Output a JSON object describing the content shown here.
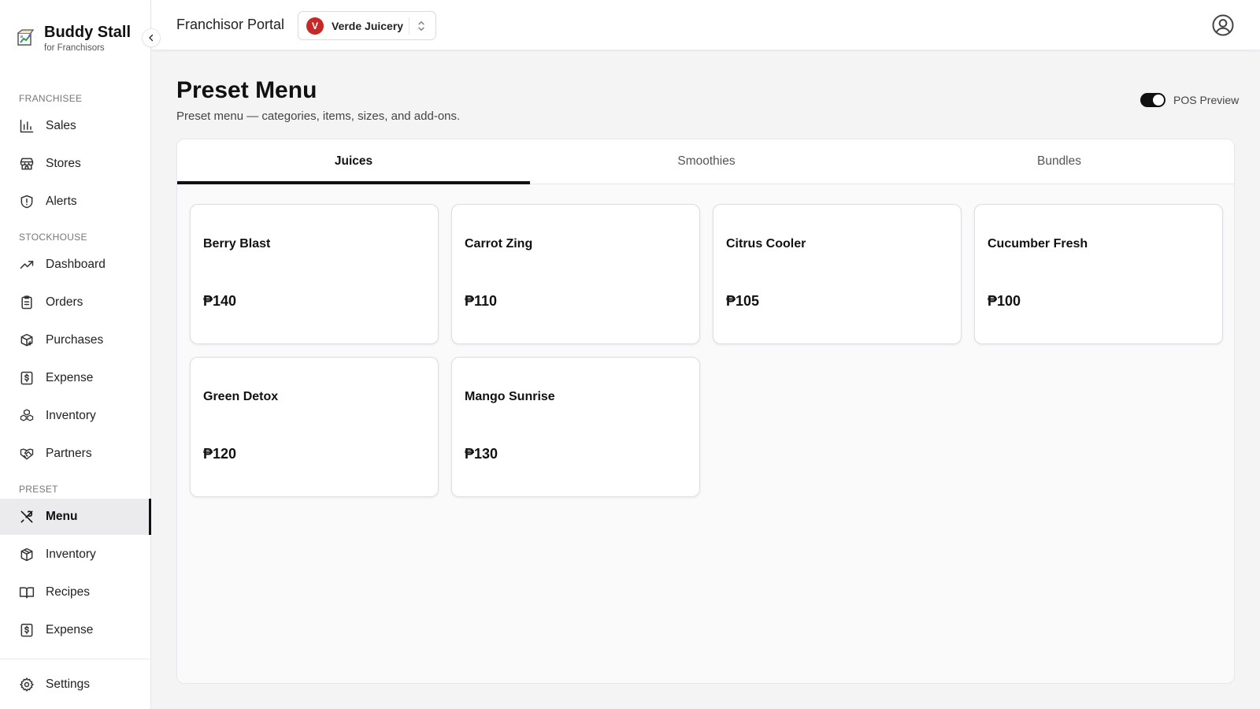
{
  "brand": {
    "name": "Buddy Stall",
    "subtitle": "for Franchisors"
  },
  "sidebar": {
    "sections": [
      {
        "title": "FRANCHISEE",
        "items": [
          {
            "label": "Sales",
            "icon": "bar-chart-icon"
          },
          {
            "label": "Stores",
            "icon": "store-icon"
          },
          {
            "label": "Alerts",
            "icon": "shield-alert-icon"
          }
        ]
      },
      {
        "title": "STOCKHOUSE",
        "items": [
          {
            "label": "Dashboard",
            "icon": "trending-up-icon"
          },
          {
            "label": "Orders",
            "icon": "clipboard-icon"
          },
          {
            "label": "Purchases",
            "icon": "package-plus-icon"
          },
          {
            "label": "Expense",
            "icon": "receipt-icon"
          },
          {
            "label": "Inventory",
            "icon": "boxes-icon"
          },
          {
            "label": "Partners",
            "icon": "handshake-icon"
          }
        ]
      },
      {
        "title": "PRESET",
        "items": [
          {
            "label": "Menu",
            "icon": "utensils-icon",
            "active": true
          },
          {
            "label": "Inventory",
            "icon": "box-icon"
          },
          {
            "label": "Recipes",
            "icon": "book-icon"
          },
          {
            "label": "Expense",
            "icon": "receipt-icon"
          }
        ]
      }
    ],
    "settings_label": "Settings"
  },
  "header": {
    "title": "Franchisor Portal",
    "selected_brand": {
      "initial": "V",
      "name": "Verde Juicery",
      "color": "#c62828"
    }
  },
  "main": {
    "title": "Preset Menu",
    "subtitle": "Preset menu — categories, items, sizes, and add-ons.",
    "pos_preview_label": "POS Preview",
    "pos_preview_on": true,
    "tabs": [
      {
        "label": "Juices",
        "active": true
      },
      {
        "label": "Smoothies"
      },
      {
        "label": "Bundles"
      }
    ],
    "items": [
      {
        "name": "Berry Blast",
        "price": "₱140"
      },
      {
        "name": "Carrot Zing",
        "price": "₱110"
      },
      {
        "name": "Citrus Cooler",
        "price": "₱105"
      },
      {
        "name": "Cucumber Fresh",
        "price": "₱100"
      },
      {
        "name": "Green Detox",
        "price": "₱120"
      },
      {
        "name": "Mango Sunrise",
        "price": "₱130"
      }
    ]
  },
  "colors": {
    "accent": "#111111",
    "sidebar_active_bg": "#ebebed",
    "brand_avatar": "#c62828"
  }
}
